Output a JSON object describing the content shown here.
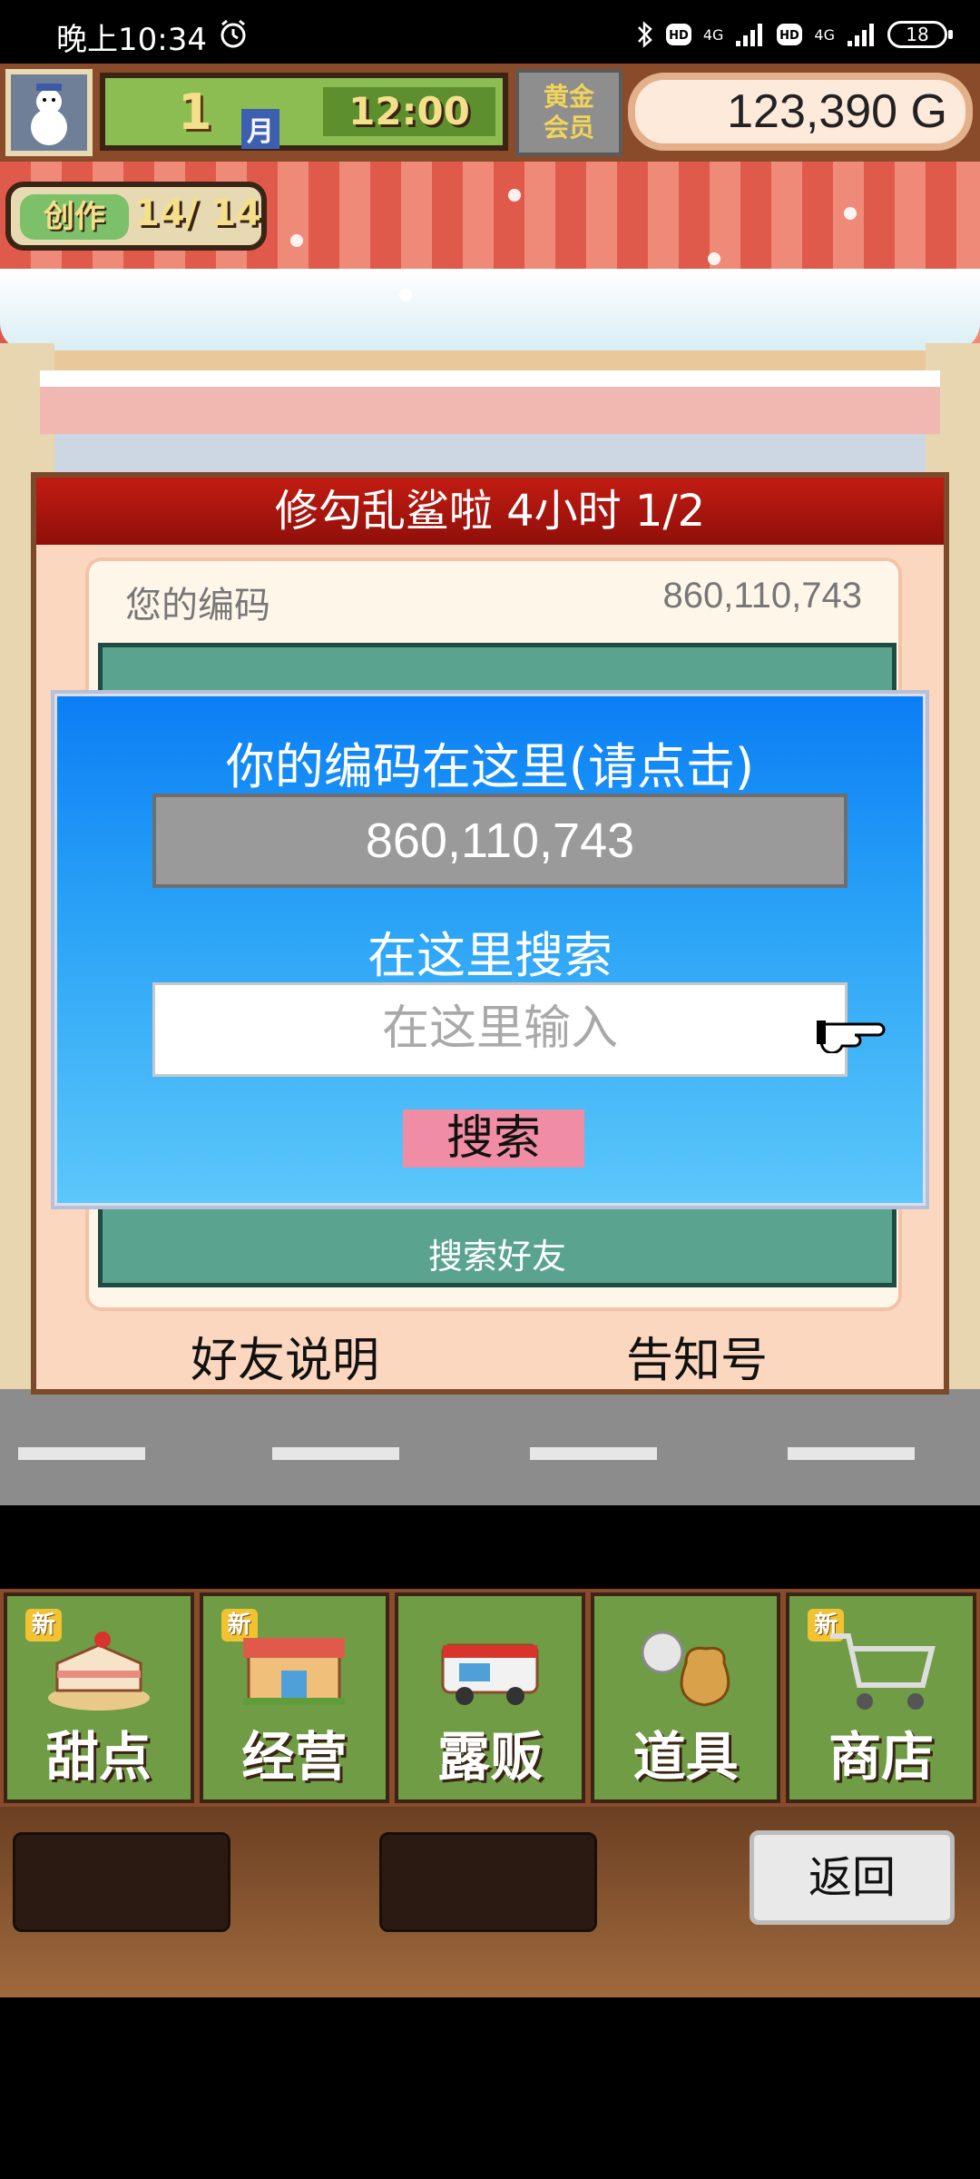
{
  "status_bar": {
    "time": "晚上10:34",
    "battery": "18",
    "network_a": "4G",
    "network_b": "4G"
  },
  "hud": {
    "month": "1",
    "month_unit": "月",
    "clock": "12:00",
    "member_badge_line1": "黄金",
    "member_badge_line2": "会员",
    "money": "123,390 G",
    "create_label": "创作",
    "create_count": "14/ 14"
  },
  "friend_dialog": {
    "title": "修勾乱鲨啦  4小时 1/2",
    "code_label": "您的编码",
    "code_value": "860,110,743",
    "search_friend_label": "搜索好友",
    "footer_left": "好友说明",
    "footer_right": "告知号"
  },
  "search_modal": {
    "title": "你的编码在这里(请点击)",
    "code_value": "860,110,743",
    "search_label": "在这里搜索",
    "search_placeholder": "在这里输入",
    "search_button": "搜索"
  },
  "menu": {
    "items": [
      {
        "label": "甜点",
        "new": "新"
      },
      {
        "label": "经营",
        "new": "新"
      },
      {
        "label": "露贩",
        "new": ""
      },
      {
        "label": "道具",
        "new": ""
      },
      {
        "label": "商店",
        "new": "新"
      }
    ]
  },
  "lower_bar": {
    "back_label": "返回"
  },
  "colors": {
    "modal_top": "#0a7ef5",
    "modal_bottom": "#5cc8fa",
    "title_red": "#c21c12",
    "menu_green": "#6f9c45",
    "search_button": "#f08ca4"
  }
}
